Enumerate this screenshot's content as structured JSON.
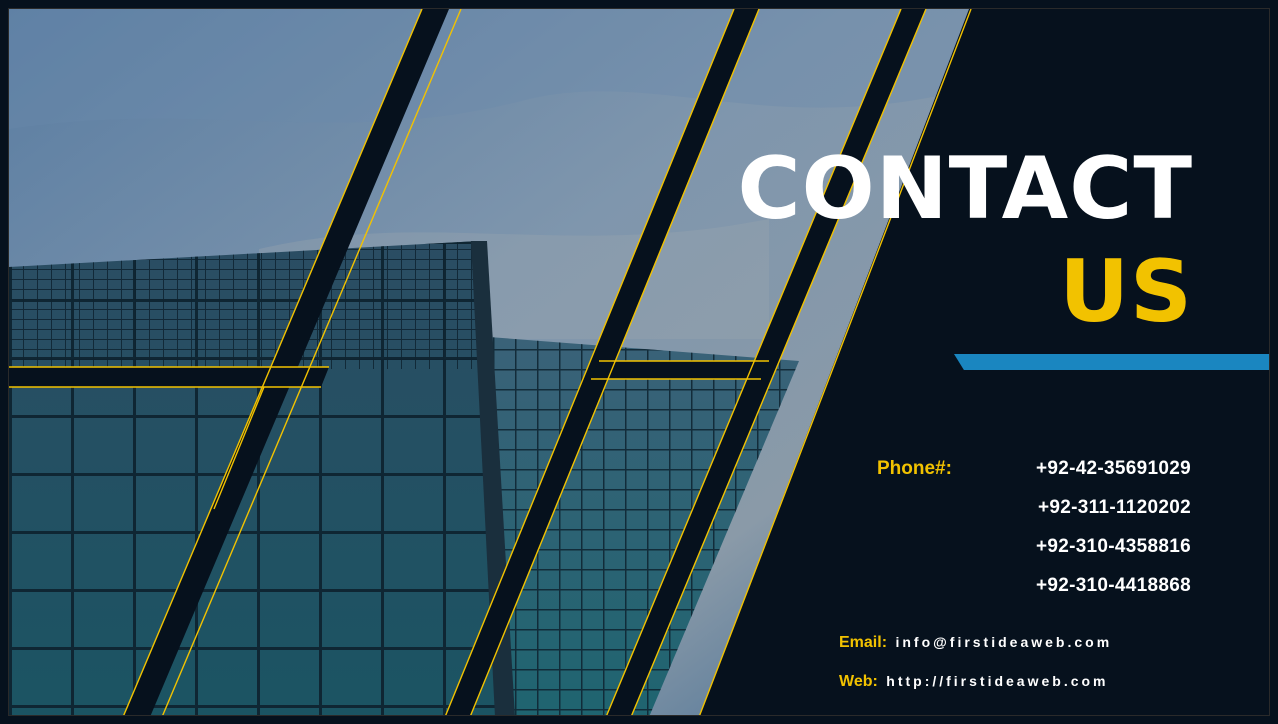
{
  "title": {
    "line1": "CONTACT",
    "line2": "US"
  },
  "phone": {
    "label": "Phone#:",
    "numbers": [
      "+92-42-35691029",
      "+92-311-1120202",
      "+92-310-4358816",
      "+92-310-4418868"
    ]
  },
  "email": {
    "label": "Email:",
    "value": "info@firstideaweb.com"
  },
  "web": {
    "label": "Web:",
    "value": "http://firstideaweb.com"
  },
  "colors": {
    "background": "#06111d",
    "title": "#ffffff",
    "accent_yellow": "#f2c200",
    "accent_blue": "#1a86c0",
    "sky": "#5d7f9f",
    "glass": "#1f5c6b"
  },
  "image": {
    "name": "skyscraper-glass-photo"
  }
}
